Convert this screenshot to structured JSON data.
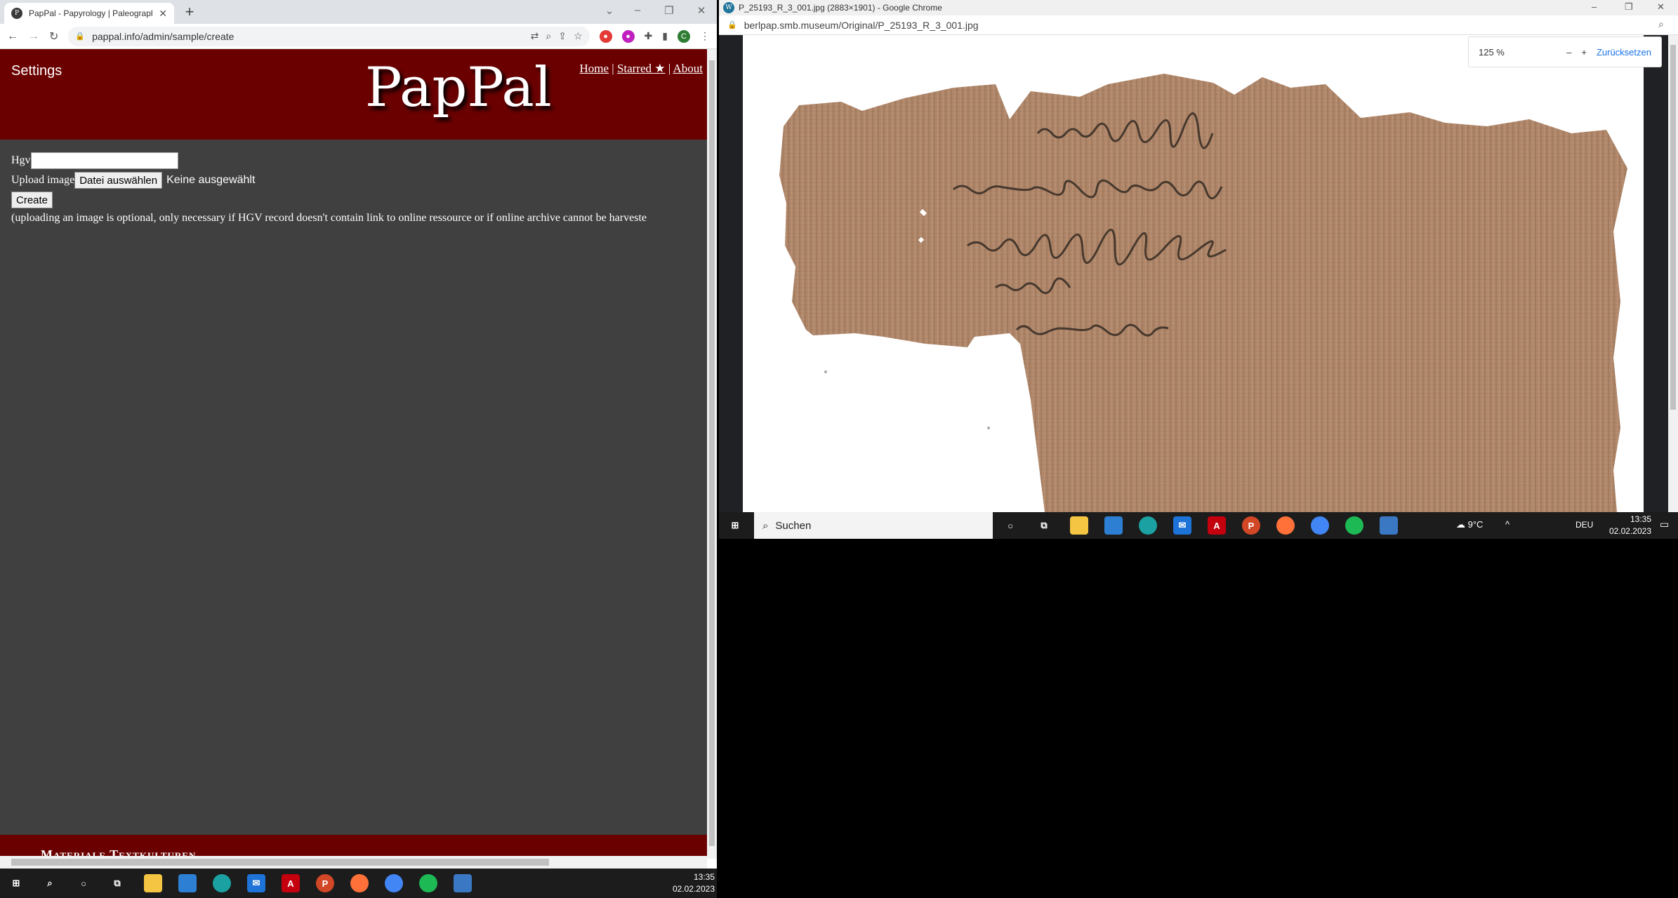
{
  "left_window": {
    "tab_title": "PapPal - Papyrology | Paleograph",
    "new_tab": "+",
    "url": "pappal.info/admin/sample/create",
    "profile_initial": "C",
    "site": {
      "settings_label": "Settings",
      "logo_text": "PapPal",
      "nav": {
        "home": "Home",
        "sep1": "|",
        "starred": "Starred ★",
        "sep2": "|",
        "about": "About"
      },
      "form": {
        "hgv_label": "Hgv",
        "hgv_value": "",
        "upload_label": "Upload image",
        "file_button": "Datei auswählen",
        "no_file": "Keine ausgewählt",
        "create_button": "Create",
        "note": "(uploading an image is optional, only necessary if HGV record doesn't contain link to online ressource or if online archive cannot be harveste"
      },
      "footer_text": "Materiale Textkulturen"
    }
  },
  "right_window": {
    "title": "P_25193_R_3_001.jpg (2883×1901) - Google Chrome",
    "url": "berlpap.smb.museum/Original/P_25193_R_3_001.jpg",
    "zoom": {
      "level": "125 %",
      "minus": "–",
      "plus": "+",
      "reset": "Zurücksetzen"
    }
  },
  "taskbar_left": {
    "time": "13:35",
    "date": "02.02.2023"
  },
  "taskbar_right": {
    "search_label": "Suchen",
    "weather": "9°C",
    "lang": "DEU",
    "time": "13:35",
    "date": "02.02.2023"
  }
}
